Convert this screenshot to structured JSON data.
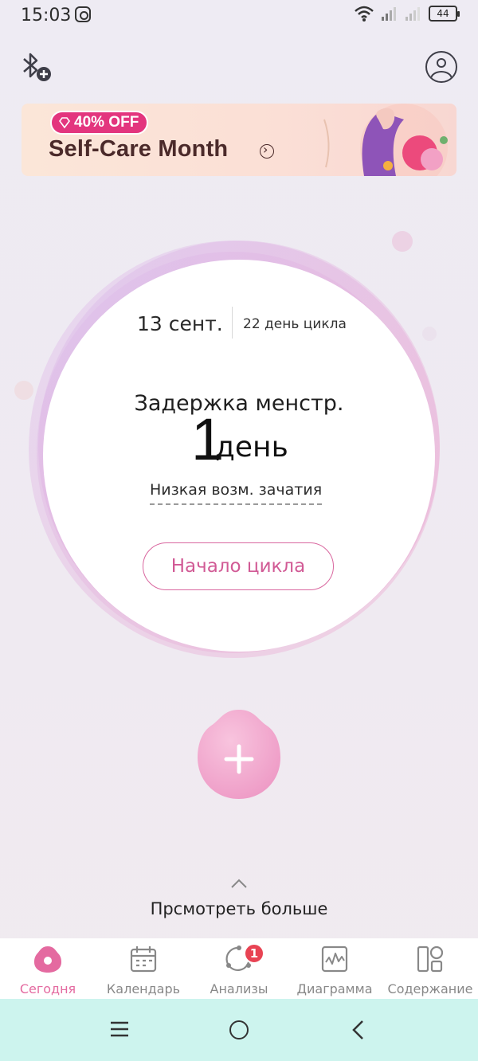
{
  "status_bar": {
    "time": "15:03",
    "battery": "44",
    "icons": [
      "instagram-icon",
      "wifi-icon",
      "signal-icon",
      "signal-icon",
      "battery-icon"
    ]
  },
  "header": {
    "left_icon": "bluetooth-add-icon",
    "right_icon": "profile-icon"
  },
  "banner": {
    "badge": "40% OFF",
    "title": "Self-Care Month",
    "arrow_icon": "arrow-right-circle-icon"
  },
  "today": {
    "date": "13 сент.",
    "cycle_day": "22 день цикла",
    "delay_label": "Задержка менстр.",
    "delay_value": "1",
    "delay_unit": "день",
    "fertility": "Низкая возм. зачатия",
    "cycle_start_button": "Начало цикла"
  },
  "add_button": {
    "icon": "plus-icon"
  },
  "see_more": {
    "label": "Прсмотреть больше",
    "icon": "chevron-up-icon"
  },
  "bottom_nav": {
    "items": [
      {
        "label": "Сегодня",
        "icon": "today-icon",
        "active": true
      },
      {
        "label": "Календарь",
        "icon": "calendar-icon",
        "active": false
      },
      {
        "label": "Анализы",
        "icon": "analysis-icon",
        "active": false,
        "badge": "1"
      },
      {
        "label": "Диаграмма",
        "icon": "chart-icon",
        "active": false
      },
      {
        "label": "Содержание",
        "icon": "content-icon",
        "active": false
      }
    ]
  },
  "colors": {
    "accent": "#e46aa0",
    "banner_badge": "#e3357e",
    "system_nav": "#cdf4ee",
    "notification_badge": "#e84353"
  }
}
